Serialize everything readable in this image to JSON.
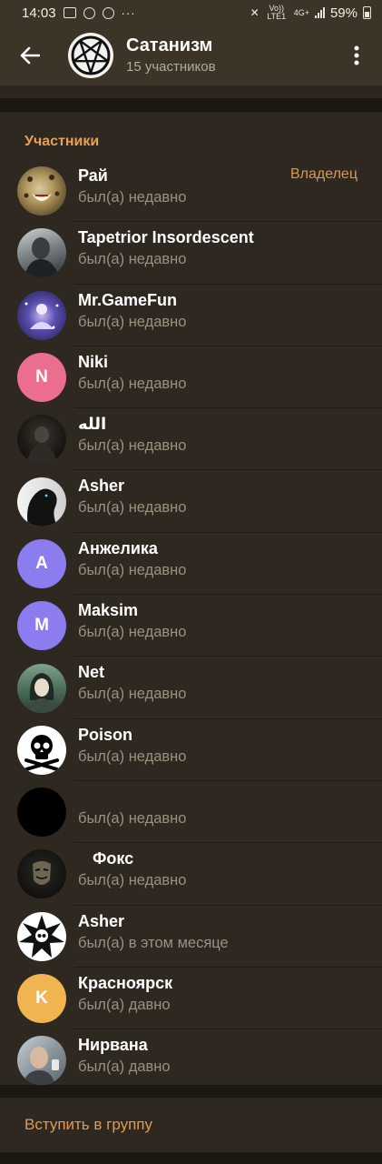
{
  "status_bar": {
    "time": "14:03",
    "network_top": "Vo)) LTE1",
    "network_type": "4G+",
    "battery": "59%"
  },
  "header": {
    "title": "Сатанизм",
    "subtitle": "15 участников"
  },
  "section_title": "Участники",
  "members": [
    {
      "name": "Рай",
      "status": "был(а) недавно",
      "role": "Владелец",
      "avatar": "leopard"
    },
    {
      "name": "Tapetrior Insordescent",
      "status": "был(а) недавно",
      "avatar": "photo-dark"
    },
    {
      "name": "Mr.GameFun",
      "status": "был(а) недавно",
      "avatar": "photo-blue"
    },
    {
      "name": "Niki",
      "status": "был(а) недавно",
      "letter": "N",
      "color": "#ec6e8f"
    },
    {
      "name": "الله",
      "status": "был(а) недавно",
      "avatar": "photo-black"
    },
    {
      "name": "Asher",
      "status": "был(а) недавно",
      "avatar": "photo-panther"
    },
    {
      "name": "Анжелика",
      "status": "был(а) недавно",
      "letter": "A",
      "color": "#8b7cf0"
    },
    {
      "name": "Maksim",
      "status": "был(а) недавно",
      "letter": "M",
      "color": "#8b7cf0"
    },
    {
      "name": "Net",
      "status": "был(а) недавно",
      "avatar": "photo-green"
    },
    {
      "name": "Poison",
      "status": "был(а) недавно",
      "avatar": "skull"
    },
    {
      "name": "",
      "status": "был(а) недавно",
      "avatar": "black"
    },
    {
      "name": "Фокс",
      "status": "был(а) недавно",
      "avatar": "mask"
    },
    {
      "name": "Asher",
      "status": "был(а) в этом месяце",
      "avatar": "skull-star"
    },
    {
      "name": "Красноярск",
      "status": "был(а) давно",
      "letter": "K",
      "color": "#f0b551"
    },
    {
      "name": "Нирвана",
      "status": "был(а) давно",
      "avatar": "photo-man"
    }
  ],
  "join_label": "Вступить в группу"
}
